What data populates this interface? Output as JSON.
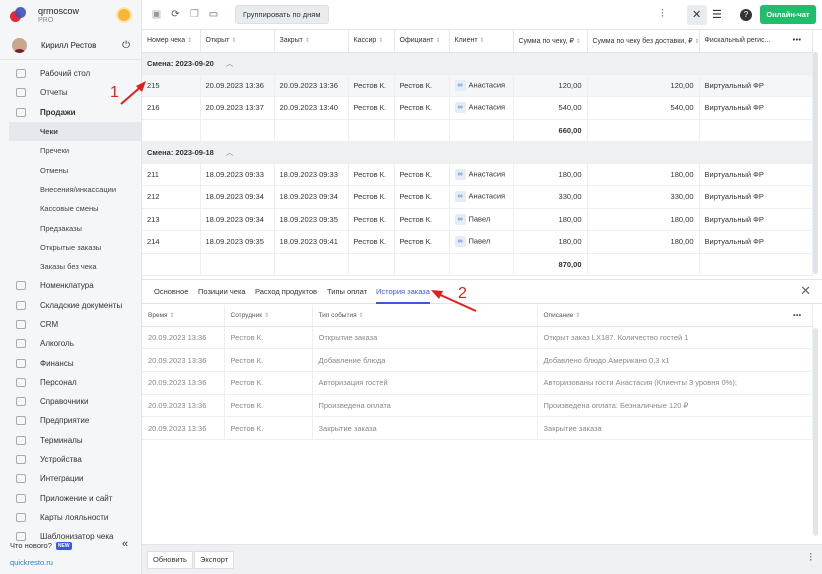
{
  "sidebar": {
    "brand": {
      "name": "qrmoscow",
      "plan": "PRO"
    },
    "user": {
      "name": "Кирилл Рестов"
    },
    "items": [
      {
        "label": "Рабочий стол",
        "icon": "desktop-icon",
        "type": "main"
      },
      {
        "label": "Отчеты",
        "icon": "reports-icon",
        "type": "main"
      },
      {
        "label": "Продажи",
        "icon": "sales-icon",
        "type": "main-bold"
      },
      {
        "label": "Чеки",
        "type": "sub-active"
      },
      {
        "label": "Пречеки",
        "type": "sub"
      },
      {
        "label": "Отмены",
        "type": "sub"
      },
      {
        "label": "Внесения/инкассации",
        "type": "sub"
      },
      {
        "label": "Кассовые смены",
        "type": "sub"
      },
      {
        "label": "Предзаказы",
        "type": "sub"
      },
      {
        "label": "Открытые заказы",
        "type": "sub"
      },
      {
        "label": "Заказы без чека",
        "type": "sub"
      },
      {
        "label": "Номенклатура",
        "icon": "nomenclature-icon",
        "type": "main"
      },
      {
        "label": "Складские документы",
        "icon": "warehouse-icon",
        "type": "main"
      },
      {
        "label": "CRM",
        "icon": "crm-icon",
        "type": "main"
      },
      {
        "label": "Алкоголь",
        "icon": "alcohol-icon",
        "type": "main"
      },
      {
        "label": "Финансы",
        "icon": "finance-icon",
        "type": "main"
      },
      {
        "label": "Персонал",
        "icon": "staff-icon",
        "type": "main"
      },
      {
        "label": "Справочники",
        "icon": "directory-icon",
        "type": "main"
      },
      {
        "label": "Предприятие",
        "icon": "enterprise-icon",
        "type": "main"
      },
      {
        "label": "Терминалы",
        "icon": "terminal-icon",
        "type": "main"
      },
      {
        "label": "Устройства",
        "icon": "devices-icon",
        "type": "main"
      },
      {
        "label": "Интеграции",
        "icon": "integrations-icon",
        "type": "main"
      },
      {
        "label": "Приложение и сайт",
        "icon": "app-icon",
        "type": "main"
      },
      {
        "label": "Карты лояльности",
        "icon": "loyalty-card-icon",
        "type": "main"
      },
      {
        "label": "Шаблонизатор чека",
        "icon": "template-icon",
        "type": "main"
      }
    ],
    "whats_new": "Что нового?",
    "new_badge": "NEW",
    "site": "quickresto.ru"
  },
  "toolbar": {
    "group_by_days": "Группировать по дням",
    "online_chat": "Онлайн-чат"
  },
  "checks_table": {
    "columns": [
      "Номер чека",
      "Открыт",
      "Закрыт",
      "Кассир",
      "Официант",
      "Клиент",
      "Сумма по чеку, ₽",
      "Сумма по чеку без доставки, ₽",
      "Фискальный регис..."
    ],
    "groups": [
      {
        "label": "Смена: 2023-09-20",
        "rows": [
          {
            "num": "215",
            "opened": "20.09.2023 13:36",
            "closed": "20.09.2023 13:36",
            "cashier": "Рестов К.",
            "waiter": "Рестов К.",
            "client": "Анастасия",
            "sum": "120,00",
            "sum_nodelivery": "120,00",
            "fiscal": "Виртуальный ФР"
          },
          {
            "num": "216",
            "opened": "20.09.2023 13:37",
            "closed": "20.09.2023 13:40",
            "cashier": "Рестов К.",
            "waiter": "Рестов К.",
            "client": "Анастасия",
            "sum": "540,00",
            "sum_nodelivery": "540,00",
            "fiscal": "Виртуальный ФР"
          }
        ],
        "total": "660,00"
      },
      {
        "label": "Смена: 2023-09-18",
        "rows": [
          {
            "num": "211",
            "opened": "18.09.2023 09:33",
            "closed": "18.09.2023 09:33",
            "cashier": "Рестов К.",
            "waiter": "Рестов К.",
            "client": "Анастасия",
            "sum": "180,00",
            "sum_nodelivery": "180,00",
            "fiscal": "Виртуальный ФР"
          },
          {
            "num": "212",
            "opened": "18.09.2023 09:34",
            "closed": "18.09.2023 09:34",
            "cashier": "Рестов К.",
            "waiter": "Рестов К.",
            "client": "Анастасия",
            "sum": "330,00",
            "sum_nodelivery": "330,00",
            "fiscal": "Виртуальный ФР"
          },
          {
            "num": "213",
            "opened": "18.09.2023 09:34",
            "closed": "18.09.2023 09:35",
            "cashier": "Рестов К.",
            "waiter": "Рестов К.",
            "client": "Павел",
            "sum": "180,00",
            "sum_nodelivery": "180,00",
            "fiscal": "Виртуальный ФР"
          },
          {
            "num": "214",
            "opened": "18.09.2023 09:35",
            "closed": "18.09.2023 09:41",
            "cashier": "Рестов К.",
            "waiter": "Рестов К.",
            "client": "Павел",
            "sum": "180,00",
            "sum_nodelivery": "180,00",
            "fiscal": "Виртуальный ФР"
          }
        ],
        "total": "870,00"
      }
    ]
  },
  "detail_tabs": [
    "Основное",
    "Позиции чека",
    "Расход продуктов",
    "Типы оплат",
    "История заказа"
  ],
  "history_table": {
    "columns": [
      "Время",
      "Сотрудник",
      "Тип события",
      "Описание"
    ],
    "rows": [
      [
        "20.09.2023 13:36",
        "Рестов К.",
        "Открытие заказа",
        "Открыт заказ LX187. Количество гостей 1"
      ],
      [
        "20.09.2023 13:36",
        "Рестов К.",
        "Добавление блюда",
        "Добавлено блюдо Американо 0,3 x1"
      ],
      [
        "20.09.2023 13:36",
        "Рестов К.",
        "Авторизация гостей",
        "Авторизованы гости Анастасия  (Клиенты 3 уровня 0%);"
      ],
      [
        "20.09.2023 13:36",
        "Рестов К.",
        "Произведена оплата",
        "Произведена оплата: Безналичные 120 ₽"
      ],
      [
        "20.09.2023 13:36",
        "Рестов К.",
        "Закрытие заказа",
        "Закрытие заказа"
      ]
    ]
  },
  "bottom": {
    "refresh": "Обновить",
    "export": "Экспорт"
  },
  "annotations": {
    "one": "1",
    "two": "2"
  },
  "colors": {
    "accent": "#3b5bdb",
    "chat": "#1fbe6c",
    "annotation": "#e0201b"
  }
}
